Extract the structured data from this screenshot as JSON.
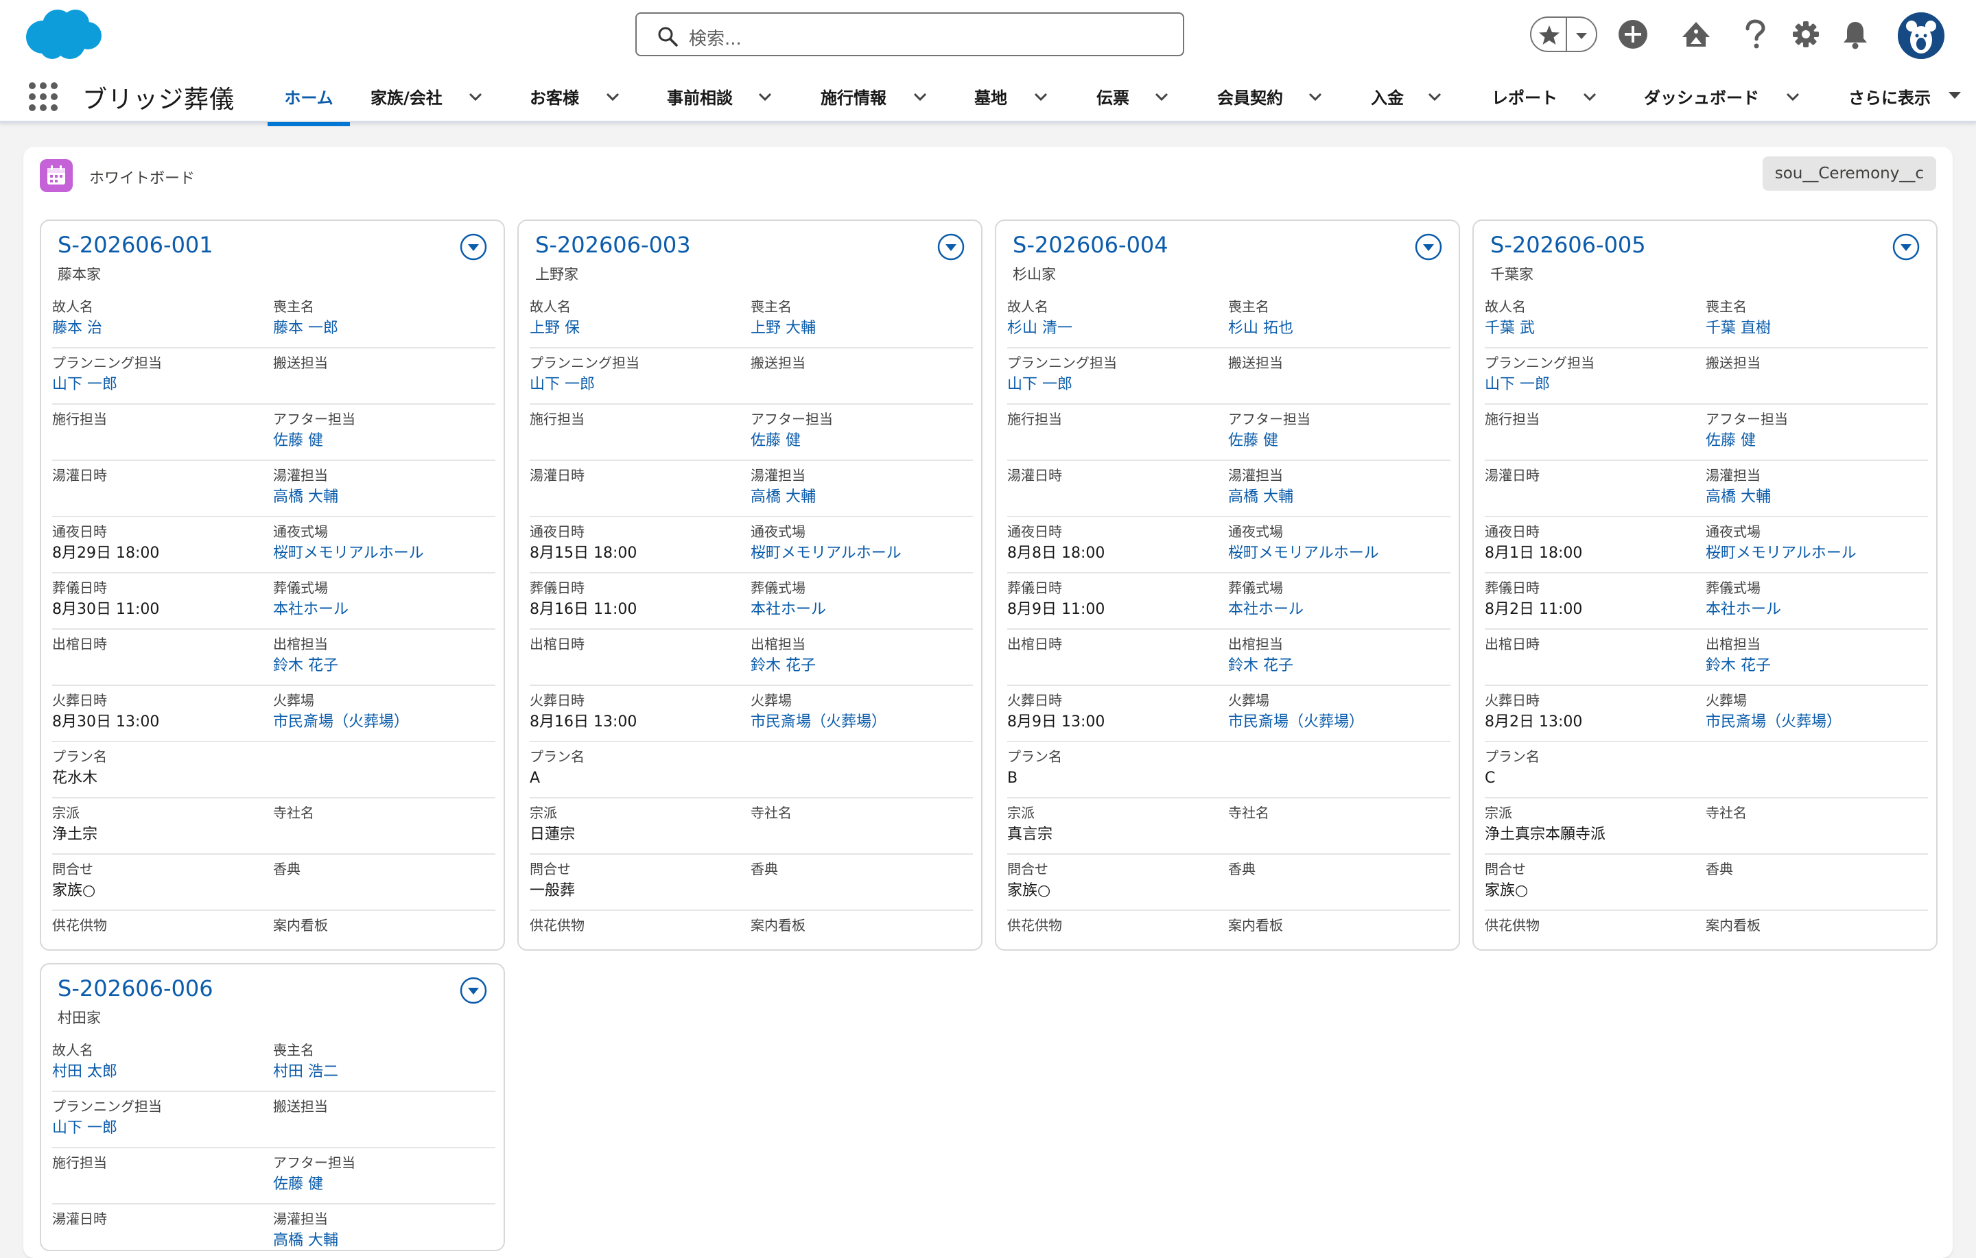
{
  "header": {
    "search_placeholder": "検索...",
    "app_name": "ブリッジ葬儀"
  },
  "nav": {
    "items": [
      {
        "label": "ホーム",
        "active": true
      },
      {
        "label": "家族/会社"
      },
      {
        "label": "お客様"
      },
      {
        "label": "事前相談"
      },
      {
        "label": "施行情報"
      },
      {
        "label": "墓地"
      },
      {
        "label": "伝票"
      },
      {
        "label": "会員契約"
      },
      {
        "label": "入金"
      },
      {
        "label": "レポート"
      },
      {
        "label": "ダッシュボード"
      },
      {
        "label": "さらに表示"
      }
    ]
  },
  "board": {
    "title": "ホワイトボード",
    "object_name": "sou__Ceremony__c"
  },
  "labels": {
    "deceased": "故人名",
    "chief_mourner": "喪主名",
    "planner": "プランニング担当",
    "transport": "搬送担当",
    "conductor": "施行担当",
    "after": "アフター担当",
    "yukan_date": "湯灌日時",
    "yukan_staff": "湯灌担当",
    "tsuya_date": "通夜日時",
    "tsuya_venue": "通夜式場",
    "funeral_date": "葬儀日時",
    "funeral_venue": "葬儀式場",
    "shukkan_date": "出棺日時",
    "shukkan_staff": "出棺担当",
    "cremation_date": "火葬日時",
    "crematorium": "火葬場",
    "plan": "プラン名",
    "sect": "宗派",
    "temple": "寺社名",
    "inquiry": "問合せ",
    "koden": "香典",
    "offerings": "供花供物",
    "signboard": "案内看板"
  },
  "cards": [
    {
      "id": "S-202606-001",
      "family": "藤本家",
      "deceased": "藤本 治",
      "chief_mourner": "藤本 一郎",
      "planner": "山下 一郎",
      "transport": "",
      "conductor": "",
      "after": "佐藤 健",
      "yukan_date": "",
      "yukan_staff": "高橋 大輔",
      "tsuya_date": "8月29日 18:00",
      "tsuya_venue": "桜町メモリアルホール",
      "funeral_date": "8月30日 11:00",
      "funeral_venue": "本社ホール",
      "shukkan_date": "",
      "shukkan_staff": "鈴木 花子",
      "cremation_date": "8月30日 13:00",
      "crematorium": "市民斎場（火葬場）",
      "plan": "花水木",
      "sect": "浄土宗",
      "temple": "",
      "inquiry": "家族○",
      "koden": "",
      "offerings": "",
      "signboard": ""
    },
    {
      "id": "S-202606-003",
      "family": "上野家",
      "deceased": "上野 保",
      "chief_mourner": "上野 大輔",
      "planner": "山下 一郎",
      "transport": "",
      "conductor": "",
      "after": "佐藤 健",
      "yukan_date": "",
      "yukan_staff": "高橋 大輔",
      "tsuya_date": "8月15日 18:00",
      "tsuya_venue": "桜町メモリアルホール",
      "funeral_date": "8月16日 11:00",
      "funeral_venue": "本社ホール",
      "shukkan_date": "",
      "shukkan_staff": "鈴木 花子",
      "cremation_date": "8月16日 13:00",
      "crematorium": "市民斎場（火葬場）",
      "plan": "A",
      "sect": "日蓮宗",
      "temple": "",
      "inquiry": "一般葬",
      "koden": "",
      "offerings": "",
      "signboard": ""
    },
    {
      "id": "S-202606-004",
      "family": "杉山家",
      "deceased": "杉山 清一",
      "chief_mourner": "杉山 拓也",
      "planner": "山下 一郎",
      "transport": "",
      "conductor": "",
      "after": "佐藤 健",
      "yukan_date": "",
      "yukan_staff": "高橋 大輔",
      "tsuya_date": "8月8日 18:00",
      "tsuya_venue": "桜町メモリアルホール",
      "funeral_date": "8月9日 11:00",
      "funeral_venue": "本社ホール",
      "shukkan_date": "",
      "shukkan_staff": "鈴木 花子",
      "cremation_date": "8月9日 13:00",
      "crematorium": "市民斎場（火葬場）",
      "plan": "B",
      "sect": "真言宗",
      "temple": "",
      "inquiry": "家族○",
      "koden": "",
      "offerings": "",
      "signboard": ""
    },
    {
      "id": "S-202606-005",
      "family": "千葉家",
      "deceased": "千葉 武",
      "chief_mourner": "千葉 直樹",
      "planner": "山下 一郎",
      "transport": "",
      "conductor": "",
      "after": "佐藤 健",
      "yukan_date": "",
      "yukan_staff": "高橋 大輔",
      "tsuya_date": "8月1日 18:00",
      "tsuya_venue": "桜町メモリアルホール",
      "funeral_date": "8月2日 11:00",
      "funeral_venue": "本社ホール",
      "shukkan_date": "",
      "shukkan_staff": "鈴木 花子",
      "cremation_date": "8月2日 13:00",
      "crematorium": "市民斎場（火葬場）",
      "plan": "C",
      "sect": "浄土真宗本願寺派",
      "temple": "",
      "inquiry": "家族○",
      "koden": "",
      "offerings": "",
      "signboard": ""
    },
    {
      "id": "S-202606-006",
      "family": "村田家",
      "deceased": "村田 太郎",
      "chief_mourner": "村田 浩二",
      "planner": "山下 一郎",
      "transport": "",
      "conductor": "",
      "after": "佐藤 健",
      "yukan_date": "",
      "yukan_staff": "高橋 大輔"
    }
  ]
}
